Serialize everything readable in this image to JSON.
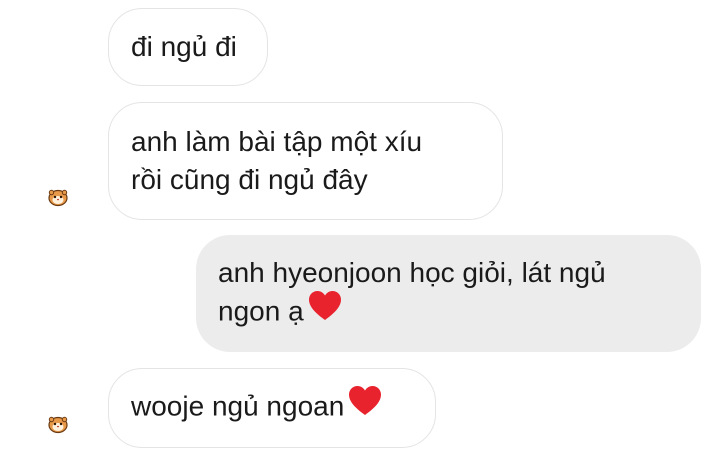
{
  "messages": [
    {
      "direction": "incoming",
      "text": "đi ngủ đi",
      "has_heart": false,
      "show_avatar": false
    },
    {
      "direction": "incoming",
      "text": "anh làm bài tập một xíu\nrồi cũng đi ngủ đây",
      "has_heart": false,
      "show_avatar": true
    },
    {
      "direction": "outgoing",
      "text": "anh hyeonjoon học giỏi, lát ngủ\nngon ạ",
      "has_heart": true,
      "show_avatar": false
    },
    {
      "direction": "incoming",
      "text": "wooje ngủ ngoan",
      "has_heart": true,
      "show_avatar": true
    }
  ],
  "icons": {
    "avatar": "hamster-sticker-icon",
    "heart": "red-heart-icon"
  },
  "colors": {
    "incoming_bubble_bg": "#ffffff",
    "incoming_bubble_border": "#e4e4e4",
    "outgoing_bubble_bg": "#ececec",
    "text": "#1a1a1a",
    "heart": "#e8232d"
  }
}
